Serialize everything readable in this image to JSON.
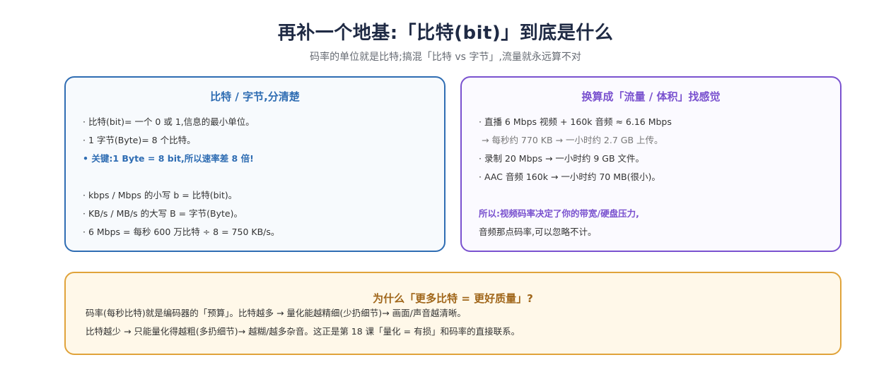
{
  "header": {
    "title": "再补一个地基:「比特(bit)」到底是什么",
    "subtitle": "码率的单位就是比特;搞混「比特 vs 字节」,流量就永远算不对"
  },
  "left_card": {
    "title": "比特 / 字节,分清楚",
    "lines": [
      "· 比特(bit)= 一个 0 或 1,信息的最小单位。",
      "· 1 字节(Byte)= 8 个比特。",
      "• 关键:1 Byte = 8 bit,所以速率差 8 倍!",
      "· kbps / Mbps 的小写 b = 比特(bit)。",
      "· KB/s / MB/s 的大写 B = 字节(Byte)。",
      "· 6 Mbps = 每秒 600 万比特 ÷ 8 = 750 KB/s。"
    ]
  },
  "right_card": {
    "title": "换算成「流量 / 体积」找感觉",
    "lines": [
      "· 直播 6 Mbps 视频 + 160k 音频 ≈ 6.16 Mbps",
      "→ 每秒约 770 KB → 一小时约 2.7 GB 上传。",
      "· 录制 20 Mbps → 一小时约 9 GB 文件。",
      "· AAC 音频 160k → 一小时约 70 MB(很小)。",
      "所以:视频码率决定了你的带宽/硬盘压力,",
      "音频那点码率,可以忽略不计。"
    ]
  },
  "bottom_card": {
    "title": "为什么「更多比特 = 更好质量」?",
    "lines": [
      "码率(每秒比特)就是编码器的「预算」。比特越多 → 量化能越精细(少扔细节)→ 画面/声音越清晰。",
      "比特越少 → 只能量化得越粗(多扔细节)→ 越糊/越多杂音。这正是第 18 课「量化 = 有损」和码率的直接联系。"
    ]
  },
  "colors": {
    "blue": "#2f6db3",
    "purple": "#7a52cf",
    "amber": "#e0a33a"
  }
}
